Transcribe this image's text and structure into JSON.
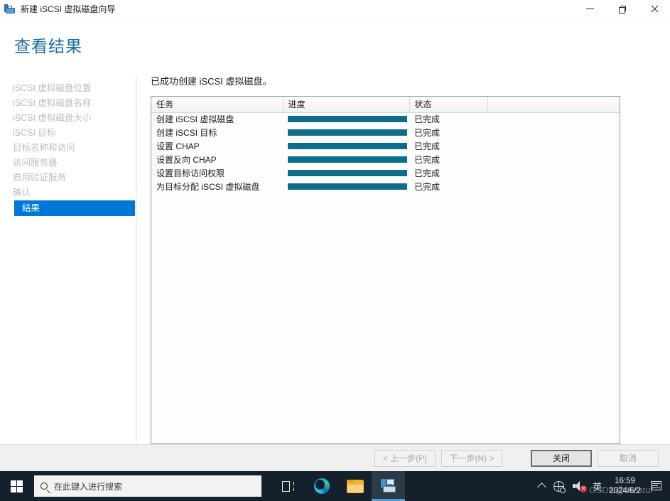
{
  "window": {
    "title": "新建 iSCSI 虚拟磁盘向导",
    "icon": "server-manager-icon",
    "controls": {
      "minimize": "最小化",
      "restore": "还原",
      "close": "关闭"
    }
  },
  "page": {
    "heading": "查看结果",
    "message": "已成功创建 iSCSI 虚拟磁盘。"
  },
  "nav": {
    "items": [
      {
        "label": "iSCSI 虚拟磁盘位置",
        "active": false
      },
      {
        "label": "iSCSI 虚拟磁盘名称",
        "active": false
      },
      {
        "label": "iSCSI 虚拟磁盘大小",
        "active": false
      },
      {
        "label": "iSCSI 目标",
        "active": false
      },
      {
        "label": "目标名称和访问",
        "active": false
      },
      {
        "label": "访问服务器",
        "active": false
      },
      {
        "label": "启用验证服务",
        "active": false
      },
      {
        "label": "确认",
        "active": false
      },
      {
        "label": "结果",
        "active": true
      }
    ]
  },
  "table": {
    "columns": [
      "任务",
      "进度",
      "状态",
      ""
    ],
    "rows": [
      {
        "task": "创建 iSCSI 虚拟磁盘",
        "progress": 100,
        "state": "已完成"
      },
      {
        "task": "创建 iSCSI 目标",
        "progress": 100,
        "state": "已完成"
      },
      {
        "task": "设置 CHAP",
        "progress": 100,
        "state": "已完成"
      },
      {
        "task": "设置反向 CHAP",
        "progress": 100,
        "state": "已完成"
      },
      {
        "task": "设置目标访问权限",
        "progress": 100,
        "state": "已完成"
      },
      {
        "task": "为目标分配 iSCSI 虚拟磁盘",
        "progress": 100,
        "state": "已完成"
      }
    ]
  },
  "footer": {
    "previous": "< 上一步(P)",
    "next": "下一步(N) >",
    "close": "关闭",
    "cancel": "取消"
  },
  "taskbar": {
    "start": "开始",
    "search_placeholder": "在此键入进行搜索",
    "apps": [
      {
        "name": "task-view",
        "label": "任务视图"
      },
      {
        "name": "edge",
        "label": "Microsoft Edge"
      },
      {
        "name": "file-explorer",
        "label": "文件资源管理器"
      },
      {
        "name": "server-manager",
        "label": "服务器管理器"
      }
    ],
    "tray": {
      "ime": "英",
      "time": "16:59",
      "date": "2024/6/2"
    }
  },
  "colors": {
    "accent_blue": "#0078d7",
    "heading_blue": "#1c6ea4",
    "progress_teal": "#0d6e8c",
    "taskbar_bg": "#14202c"
  },
  "watermark": "CSDN@Meatuf"
}
